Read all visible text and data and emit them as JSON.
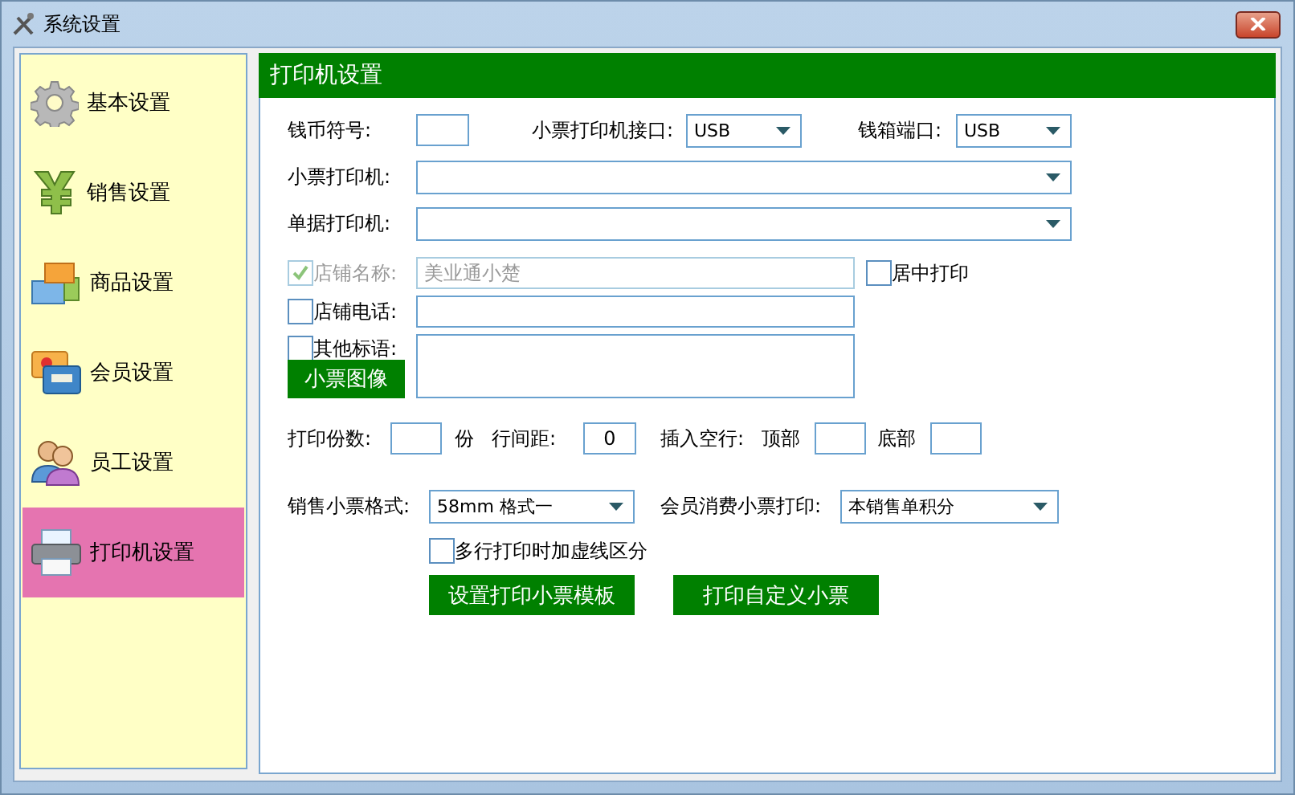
{
  "window": {
    "title": "系统设置"
  },
  "sidebar": {
    "items": [
      {
        "label": "基本设置",
        "kind": "gear",
        "selected": false
      },
      {
        "label": "销售设置",
        "kind": "yen",
        "selected": false
      },
      {
        "label": "商品设置",
        "kind": "blocks",
        "selected": false
      },
      {
        "label": "会员设置",
        "kind": "cards",
        "selected": false
      },
      {
        "label": "员工设置",
        "kind": "people",
        "selected": false
      },
      {
        "label": "打印机设置",
        "kind": "printer",
        "selected": true
      }
    ]
  },
  "panel": {
    "title": "打印机设置",
    "currency_symbol": {
      "label": "钱币符号:"
    },
    "receipt_port": {
      "label": "小票打印机接口:",
      "value": "USB"
    },
    "cashbox_port": {
      "label": "钱箱端口:",
      "value": "USB"
    },
    "receipt_printer": {
      "label": "小票打印机:"
    },
    "document_printer": {
      "label": "单据打印机:"
    },
    "shop_name": {
      "label": "店铺名称:",
      "checked": true,
      "disabled": true,
      "value": "美业通小楚"
    },
    "center_print": {
      "label": "居中打印",
      "checked": false
    },
    "shop_phone": {
      "label": "店铺电话:",
      "checked": false
    },
    "slogan": {
      "label": "其他标语:",
      "checked": false
    },
    "receipt_image_button": "小票图像",
    "copies": {
      "label": "打印份数:",
      "unit": "份"
    },
    "line_spacing": {
      "label": "行间距:",
      "value": "0"
    },
    "blank_lines": {
      "label": "插入空行:",
      "top_label": "顶部",
      "bottom_label": "底部"
    },
    "receipt_format": {
      "label": "销售小票格式:",
      "value": "58mm 格式一"
    },
    "member_receipt": {
      "label": "会员消费小票打印:",
      "value": "本销售单积分"
    },
    "dashed_separator": {
      "label": "多行打印时加虚线区分",
      "checked": false
    },
    "buttons": [
      "设置打印小票模板",
      "打印自定义小票"
    ]
  }
}
